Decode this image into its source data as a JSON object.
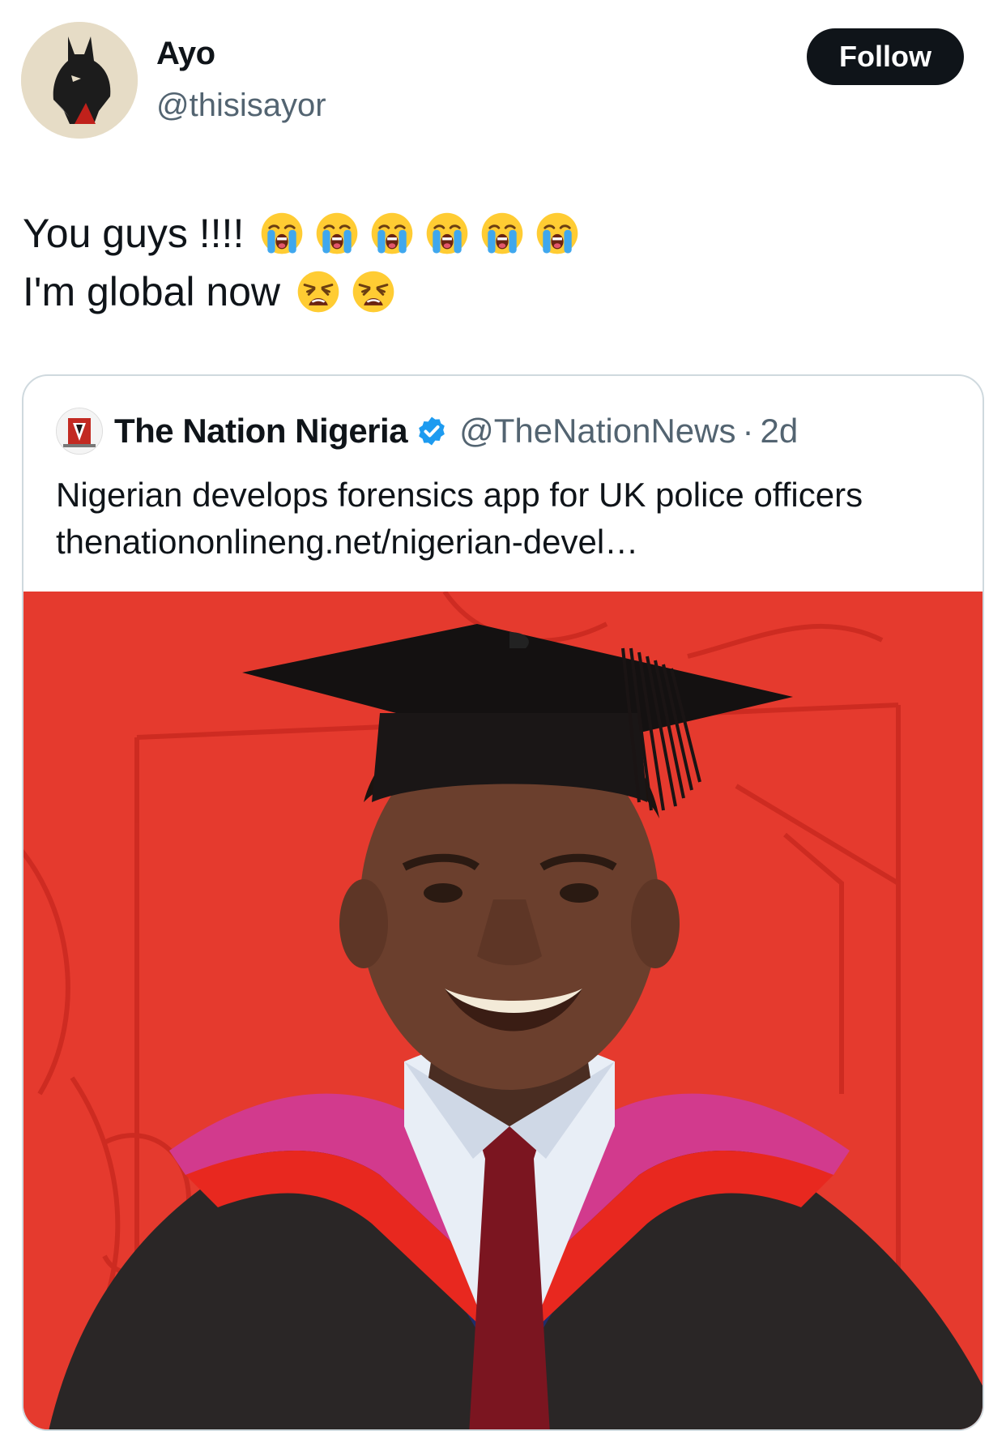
{
  "tweet": {
    "author_name": "Ayo",
    "author_handle": "@thisisayor",
    "follow_label": "Follow",
    "line1": "You guys !!!!",
    "line2": "I'm global now",
    "line1_emojis": [
      "loudly-crying-face",
      "loudly-crying-face",
      "loudly-crying-face",
      "loudly-crying-face",
      "loudly-crying-face",
      "loudly-crying-face"
    ],
    "line2_emojis": [
      "weary-face",
      "weary-face"
    ]
  },
  "quote": {
    "name": "The Nation Nigeria",
    "handle": "@TheNationNews",
    "separator": "·",
    "time": "2d",
    "text": "Nigerian develops forensics app for UK police officers thenationonlineng.net/nigerian-devel…",
    "verified_icon": "verified-badge-icon",
    "media_icon": "graduate-photo"
  },
  "colors": {
    "follow_bg": "#0f1419",
    "handle_gray": "#536471",
    "verified_blue": "#1d9bf0",
    "media_red": "#e53a2e"
  }
}
